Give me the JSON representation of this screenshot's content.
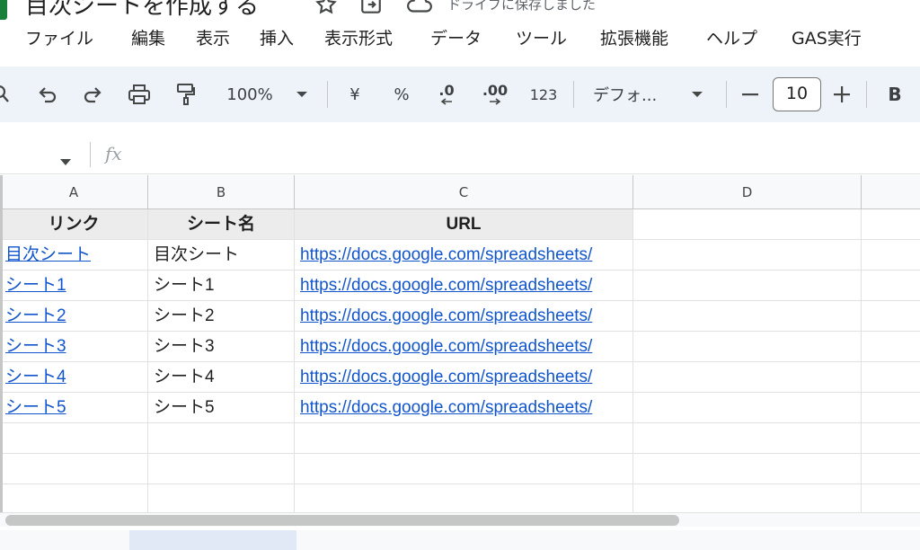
{
  "document": {
    "title": "目次シートを作成する",
    "save_status": "ドライブに保存しました"
  },
  "menu": {
    "items": [
      "ファイル",
      "編集",
      "表示",
      "挿入",
      "表示形式",
      "データ",
      "ツール",
      "拡張機能",
      "ヘルプ",
      "GAS実行"
    ]
  },
  "toolbar": {
    "zoom": "100%",
    "currency": "¥",
    "percent": "%",
    "decrease_decimal": ".0",
    "increase_decimal": ".00",
    "number_format": "123",
    "font": "デフォ...",
    "font_size": "10",
    "bold": "B"
  },
  "formula_bar": {
    "fx": "fx"
  },
  "sheet": {
    "columns": [
      "A",
      "B",
      "C",
      "D"
    ],
    "header": [
      "リンク",
      "シート名",
      "URL"
    ],
    "rows": [
      [
        "目次シート",
        "目次シート",
        "https://docs.google.com/spreadsheets/"
      ],
      [
        "シート1",
        "シート1",
        "https://docs.google.com/spreadsheets/"
      ],
      [
        "シート2",
        "シート2",
        "https://docs.google.com/spreadsheets/"
      ],
      [
        "シート3",
        "シート3",
        "https://docs.google.com/spreadsheets/"
      ],
      [
        "シート4",
        "シート4",
        "https://docs.google.com/spreadsheets/"
      ],
      [
        "シート5",
        "シート5",
        "https://docs.google.com/spreadsheets/"
      ]
    ]
  },
  "colors": {
    "link": "#1155cc",
    "toolbar_bg": "#eef3fa",
    "header_row_bg": "#ececec",
    "logo_green": "#188038"
  }
}
